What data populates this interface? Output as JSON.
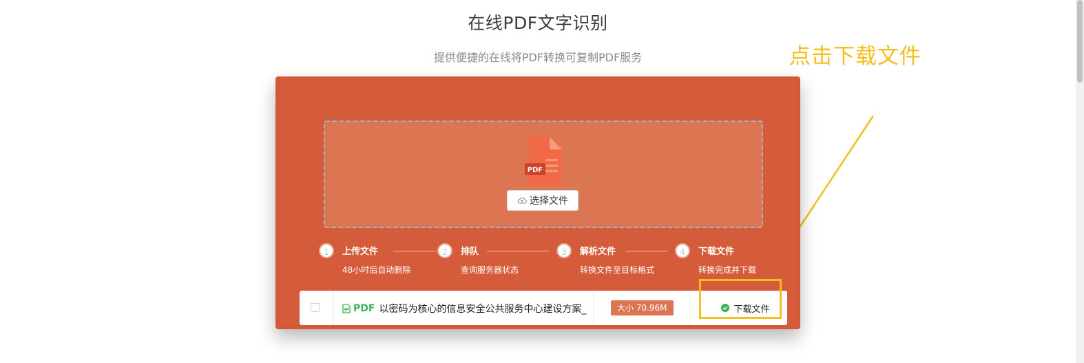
{
  "header": {
    "title": "在线PDF文字识别",
    "subtitle": "提供便捷的在线将PDF转换可复制PDF服务"
  },
  "annotation": {
    "text": "点击下载文件",
    "color": "#f7bd1d"
  },
  "upload": {
    "pdf_icon_label": "PDF",
    "select_button": "选择文件"
  },
  "steps": [
    {
      "number": "1",
      "title": "上传文件",
      "desc": "48小时后自动删除"
    },
    {
      "number": "2",
      "title": "排队",
      "desc": "查询服务器状态"
    },
    {
      "number": "3",
      "title": "解析文件",
      "desc": "转换文件至目标格式"
    },
    {
      "number": "4",
      "title": "下载文件",
      "desc": "转换完成并下载"
    }
  ],
  "file": {
    "type_tag": "PDF",
    "name": "以密码为核心的信息安全公共服务中心建设方案_",
    "size": "大小 70.96M",
    "download_label": "下载文件"
  },
  "colors": {
    "panel": "#d45a37",
    "dropzone": "#dc7551",
    "accent_green": "#3fb257",
    "annotation_yellow": "#f7bd1d"
  }
}
